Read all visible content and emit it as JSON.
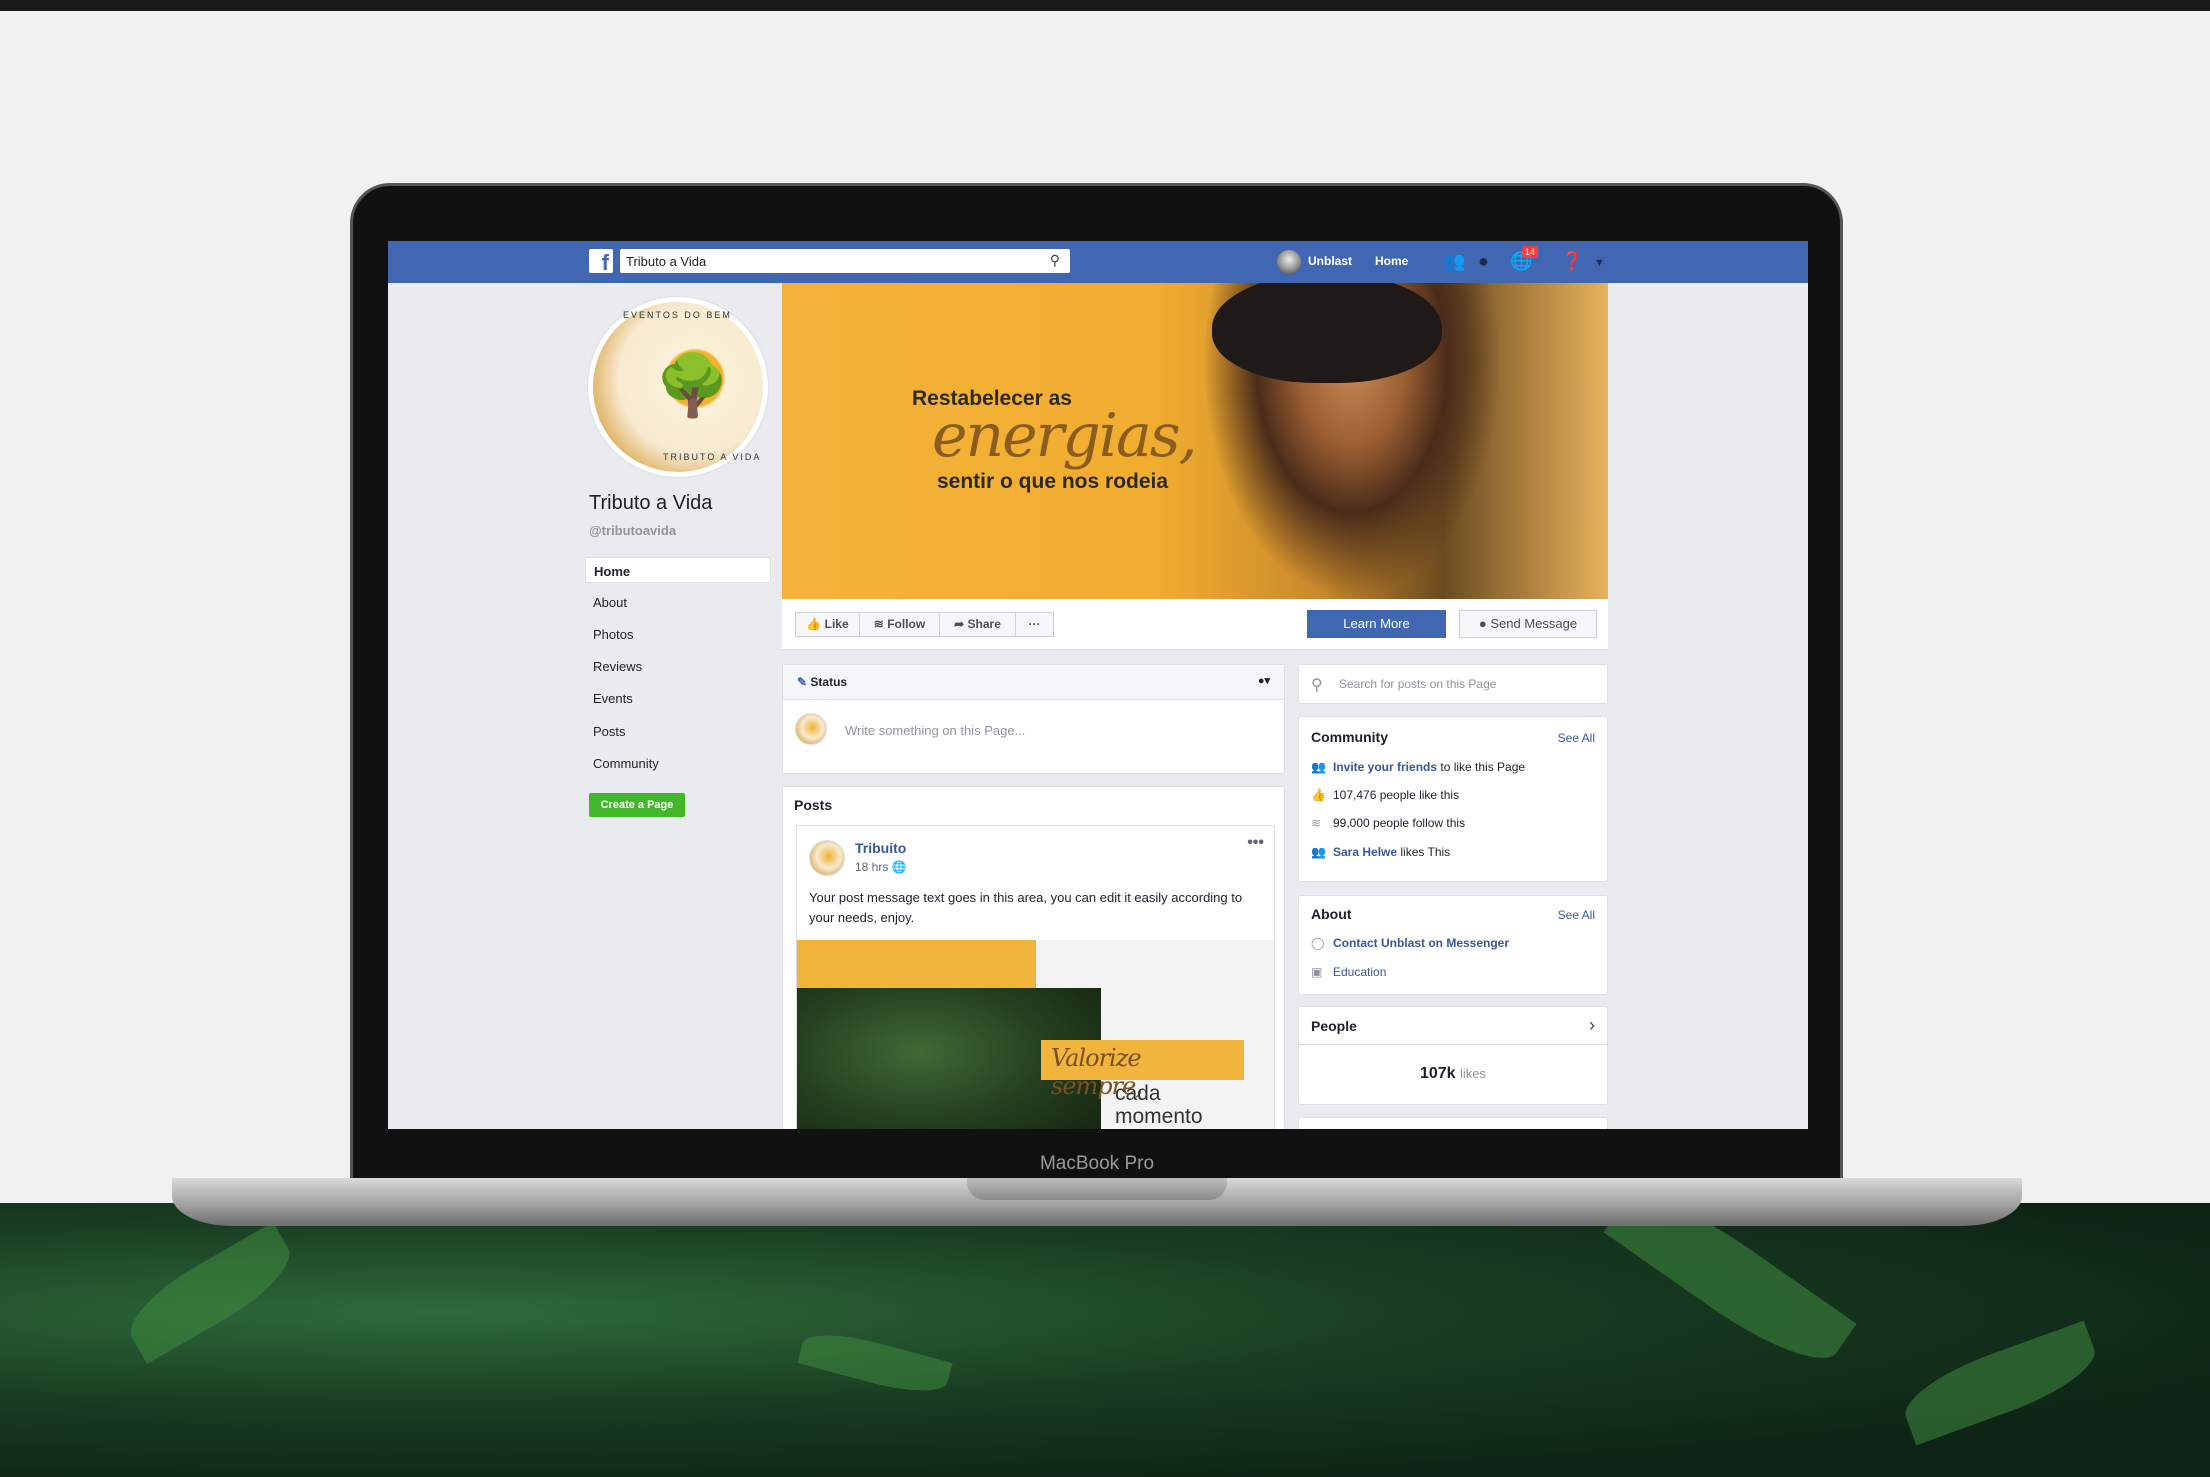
{
  "device": {
    "label": "MacBook Pro"
  },
  "nav": {
    "search_value": "Tributo a Vida",
    "user": "Unblast",
    "home": "Home",
    "notifications_count": "14",
    "color": "#4267b2"
  },
  "page": {
    "name": "Tributo a Vida",
    "handle": "@tributoavida",
    "logo_text": "EVENTOS DO BEM · TRIBUTO A VIDA"
  },
  "sidebar": {
    "items": [
      {
        "label": "Home",
        "active": true
      },
      {
        "label": "About"
      },
      {
        "label": "Photos"
      },
      {
        "label": "Reviews"
      },
      {
        "label": "Events"
      },
      {
        "label": "Posts"
      },
      {
        "label": "Community"
      }
    ],
    "create_page": "Create a Page"
  },
  "cover": {
    "line1": "Restabelecer as",
    "line2": "energias,",
    "line3": "sentir o que nos rodeia"
  },
  "actions": {
    "like": "Like",
    "follow": "Follow",
    "share": "Share",
    "more": "···",
    "learn_more": "Learn More",
    "send_message": "Send Message"
  },
  "status": {
    "title": "Status",
    "placeholder": "Write something on this Page..."
  },
  "posts": {
    "title": "Posts",
    "author": "Tribuito",
    "time": "18 hrs",
    "text": "Your post message text goes in this area, you can edit it easily according to your needs, enjoy.",
    "image_title": "Valorize sempre,",
    "image_sub1": "cada",
    "image_sub2": "momento"
  },
  "right": {
    "search_placeholder": "Search for posts on this Page",
    "community": {
      "title": "Community",
      "see_all": "See All",
      "invite_link": "Invite your friends",
      "invite_rest": " to like this Page",
      "likes": "107,476 people like this",
      "follows": "99,000 people follow this",
      "friend": "Sara Helwe",
      "friend_rest": " likes This"
    },
    "about": {
      "title": "About",
      "see_all": "See All",
      "messenger": "Contact Unblast on Messenger",
      "category": "Education"
    },
    "people": {
      "title": "People",
      "count": "107k",
      "unit": "likes"
    }
  }
}
